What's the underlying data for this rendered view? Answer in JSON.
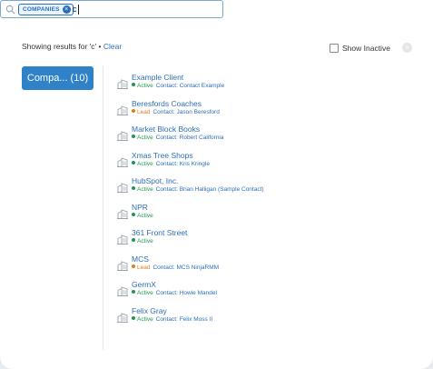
{
  "search": {
    "chip_label": "COMPANIES",
    "query": "c"
  },
  "results": {
    "prefix": "Showing results for 'c' • ",
    "clear_label": "Clear",
    "show_inactive_label": "Show Inactive",
    "show_inactive_checked": false
  },
  "category": {
    "label": "Compa... (10)"
  },
  "colors": {
    "accent": "#2f82c8",
    "link": "#2c6fb7",
    "active": "#219653",
    "lead": "#e07b1a"
  },
  "companies": [
    {
      "name": "Example Client",
      "status": "Active",
      "contact": "Contact: Contact Example"
    },
    {
      "name": "Beresfords Coaches",
      "status": "Lead",
      "contact": "Contact: Jason Beresford"
    },
    {
      "name": "Market Block Books",
      "status": "Active",
      "contact": "Contact: Robert California"
    },
    {
      "name": "Xmas Tree Shops",
      "status": "Active",
      "contact": "Contact: Kris Kringle"
    },
    {
      "name": "HubSpot, Inc.",
      "status": "Active",
      "contact": "Contact: Brian Halligan (Sample Contact)"
    },
    {
      "name": "NPR",
      "status": "Active",
      "contact": ""
    },
    {
      "name": "361 Front Street",
      "status": "Active",
      "contact": ""
    },
    {
      "name": "MCS",
      "status": "Lead",
      "contact": "Contact: MCS NinjaRMM"
    },
    {
      "name": "GermX",
      "status": "Active",
      "contact": "Contact: Howie Mandel"
    },
    {
      "name": "Felix Gray",
      "status": "Active",
      "contact": "Contact: Felix Moss II"
    }
  ]
}
